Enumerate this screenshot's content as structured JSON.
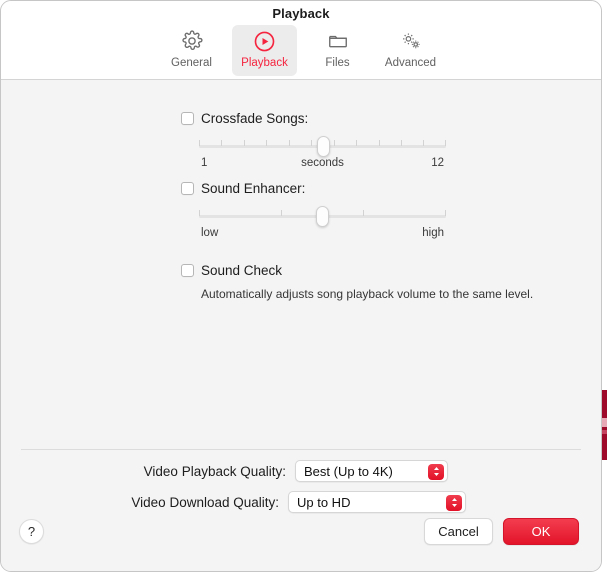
{
  "window": {
    "title": "Playback"
  },
  "toolbar": {
    "tabs": [
      {
        "label": "General",
        "icon": "gear-icon",
        "selected": false
      },
      {
        "label": "Playback",
        "icon": "play-circle-icon",
        "selected": true
      },
      {
        "label": "Files",
        "icon": "folder-icon",
        "selected": false
      },
      {
        "label": "Advanced",
        "icon": "gears-icon",
        "selected": false
      }
    ]
  },
  "settings": {
    "crossfade": {
      "label": "Crossfade Songs:",
      "checked": false,
      "slider": {
        "min_label": "1",
        "unit_label": "seconds",
        "max_label": "12",
        "min": 1,
        "max": 12,
        "value": 6,
        "ticks": 12
      }
    },
    "sound_enhancer": {
      "label": "Sound Enhancer:",
      "checked": false,
      "slider": {
        "min_label": "low",
        "max_label": "high",
        "min": 0,
        "max": 100,
        "value": 50,
        "ticks": 4
      }
    },
    "sound_check": {
      "label": "Sound Check",
      "checked": false,
      "description": "Automatically adjusts song playback volume to the same level."
    }
  },
  "video": {
    "playback_quality": {
      "label": "Video Playback Quality:",
      "value": "Best (Up to 4K)"
    },
    "download_quality": {
      "label": "Video Download Quality:",
      "value": "Up to HD"
    }
  },
  "footer": {
    "help_label": "?",
    "cancel_label": "Cancel",
    "ok_label": "OK"
  },
  "colors": {
    "accent_red": "#e3142a",
    "tab_selected_text": "#f5243f",
    "window_background": "#f4f4f4",
    "titlebar_background": "#ffffff"
  }
}
